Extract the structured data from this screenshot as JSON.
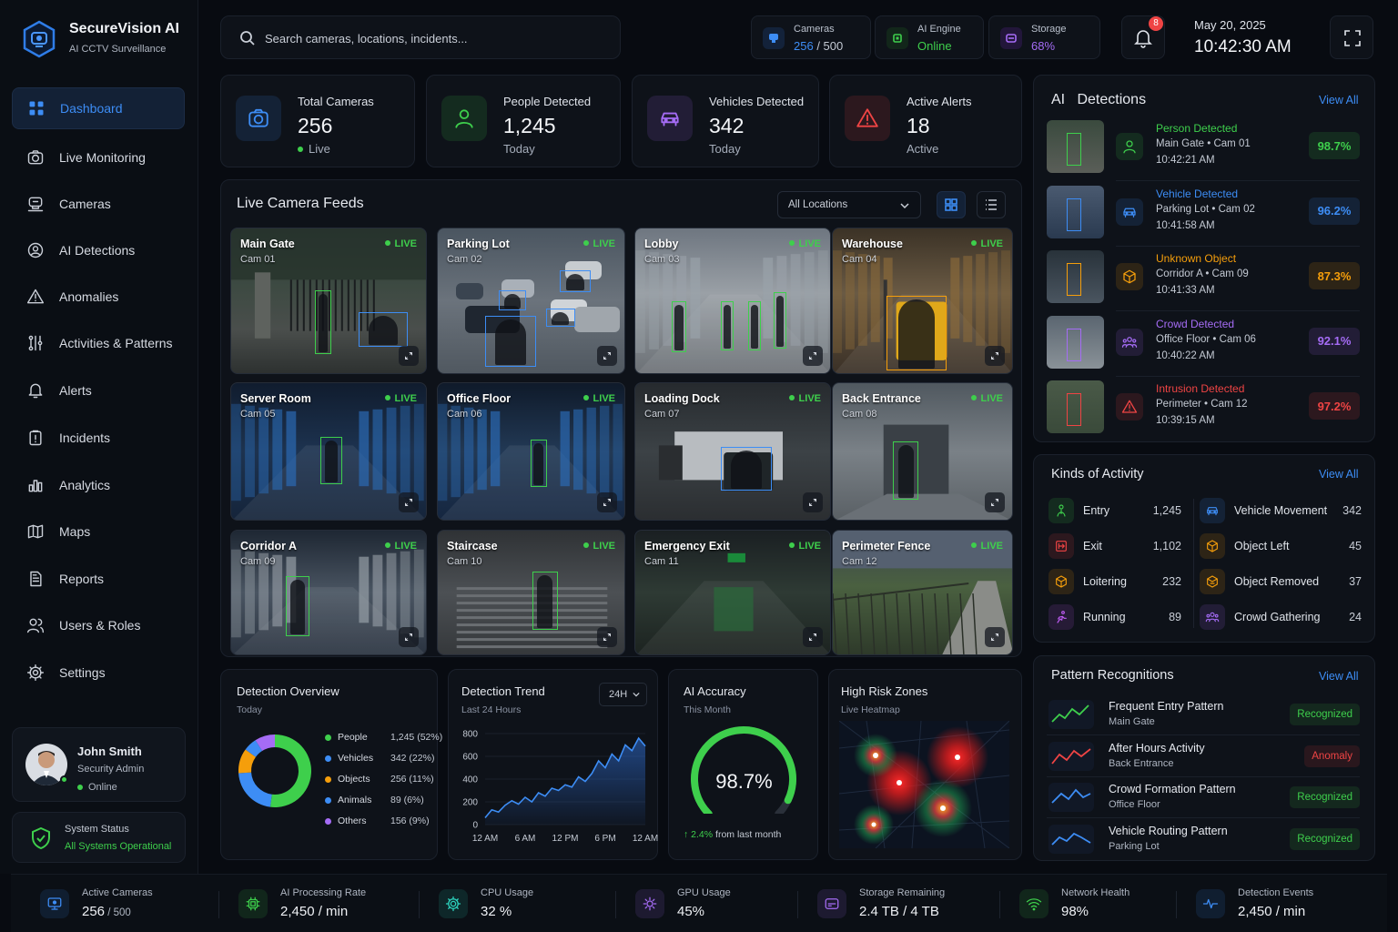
{
  "brand": {
    "name": "SecureVision AI",
    "tagline": "AI CCTV Surveillance"
  },
  "nav": [
    {
      "label": "Dashboard",
      "icon": "grid-icon",
      "active": true
    },
    {
      "label": "Live Monitoring",
      "icon": "camera-icon"
    },
    {
      "label": "Cameras",
      "icon": "cctv-icon"
    },
    {
      "label": "AI Detections",
      "icon": "face-scan-icon"
    },
    {
      "label": "Anomalies",
      "icon": "warning-icon"
    },
    {
      "label": "Activities & Patterns",
      "icon": "pattern-icon"
    },
    {
      "label": "Alerts",
      "icon": "bell-icon"
    },
    {
      "label": "Incidents",
      "icon": "clipboard-icon"
    },
    {
      "label": "Analytics",
      "icon": "bar-chart-icon"
    },
    {
      "label": "Maps",
      "icon": "map-icon"
    },
    {
      "label": "Reports",
      "icon": "document-icon"
    },
    {
      "label": "Users & Roles",
      "icon": "users-icon"
    },
    {
      "label": "Settings",
      "icon": "gear-icon"
    }
  ],
  "user": {
    "name": "John Smith",
    "role": "Security Admin",
    "status": "Online"
  },
  "system": {
    "label": "System Status",
    "value": "All Systems Operational"
  },
  "search": {
    "placeholder": "Search cameras, locations, incidents..."
  },
  "header": {
    "cameras": {
      "label": "Cameras",
      "active": "256",
      "total": "/ 500"
    },
    "engine": {
      "label": "AI Engine",
      "value": "Online"
    },
    "storage": {
      "label": "Storage",
      "value": "68%"
    },
    "notifications": "8",
    "date": "May 20, 2025",
    "time": "10:42:30 AM"
  },
  "stats": [
    {
      "title": "Total Cameras",
      "value": "256",
      "sub": "Live",
      "icon": "camera-icon",
      "color": "#3d8df5"
    },
    {
      "title": "People Detected",
      "value": "1,245",
      "sub": "Today",
      "icon": "person-icon",
      "color": "#3ecf4c"
    },
    {
      "title": "Vehicles Detected",
      "value": "342",
      "sub": "Today",
      "icon": "car-icon",
      "color": "#a56cf5"
    },
    {
      "title": "Active Alerts",
      "value": "18",
      "sub": "Active",
      "icon": "alert-icon",
      "color": "#ef4444"
    }
  ],
  "feeds": {
    "title": "Live Camera Feeds",
    "filter": "All Locations",
    "live_label": "LIVE",
    "cameras": [
      {
        "name": "Main Gate",
        "cam": "Cam 01"
      },
      {
        "name": "Parking Lot",
        "cam": "Cam 02"
      },
      {
        "name": "Lobby",
        "cam": "Cam 03"
      },
      {
        "name": "Warehouse",
        "cam": "Cam 04"
      },
      {
        "name": "Server Room",
        "cam": "Cam 05"
      },
      {
        "name": "Office Floor",
        "cam": "Cam 06"
      },
      {
        "name": "Loading Dock",
        "cam": "Cam 07"
      },
      {
        "name": "Back Entrance",
        "cam": "Cam 08"
      },
      {
        "name": "Corridor A",
        "cam": "Cam 09"
      },
      {
        "name": "Staircase",
        "cam": "Cam 10"
      },
      {
        "name": "Emergency Exit",
        "cam": "Cam 11"
      },
      {
        "name": "Perimeter Fence",
        "cam": "Cam 12"
      }
    ]
  },
  "detections": {
    "title_ai": "AI",
    "title": "Detections",
    "view_all": "View All",
    "items": [
      {
        "type": "Person Detected",
        "loc": "Main Gate • Cam 01",
        "time": "10:42:21 AM",
        "conf": "98.7%",
        "color": "#3ecf4c",
        "icon": "person-icon"
      },
      {
        "type": "Vehicle Detected",
        "loc": "Parking Lot • Cam 02",
        "time": "10:41:58 AM",
        "conf": "96.2%",
        "color": "#3d8df5",
        "icon": "car-icon"
      },
      {
        "type": "Unknown Object",
        "loc": "Corridor A • Cam 09",
        "time": "10:41:33 AM",
        "conf": "87.3%",
        "color": "#f59e0b",
        "icon": "box-icon"
      },
      {
        "type": "Crowd Detected",
        "loc": "Office Floor • Cam 06",
        "time": "10:40:22 AM",
        "conf": "92.1%",
        "color": "#a56cf5",
        "icon": "crowd-icon"
      },
      {
        "type": "Intrusion Detected",
        "loc": "Perimeter • Cam 12",
        "time": "10:39:15 AM",
        "conf": "97.2%",
        "color": "#ef4444",
        "icon": "alert-icon"
      }
    ]
  },
  "activity": {
    "title": "Kinds of Activity",
    "view_all": "View All",
    "items": [
      {
        "name": "Entry",
        "count": "1,245",
        "color": "#3ecf4c",
        "icon": "entry-icon"
      },
      {
        "name": "Vehicle Movement",
        "count": "342",
        "color": "#3d8df5",
        "icon": "car-icon"
      },
      {
        "name": "Exit",
        "count": "1,102",
        "color": "#ef4444",
        "icon": "exit-icon"
      },
      {
        "name": "Object Left",
        "count": "45",
        "color": "#f59e0b",
        "icon": "box-icon"
      },
      {
        "name": "Loitering",
        "count": "232",
        "color": "#f59e0b",
        "icon": "box-icon"
      },
      {
        "name": "Object Removed",
        "count": "37",
        "color": "#f59e0b",
        "icon": "box-remove-icon"
      },
      {
        "name": "Running",
        "count": "89",
        "color": "#c05cf5",
        "icon": "running-icon"
      },
      {
        "name": "Crowd Gathering",
        "count": "24",
        "color": "#a56cf5",
        "icon": "crowd-icon"
      }
    ]
  },
  "patterns": {
    "title": "Pattern Recognitions",
    "view_all": "View All",
    "items": [
      {
        "name": "Frequent Entry Pattern",
        "loc": "Main Gate",
        "badge": "Recognized",
        "color": "#3ecf4c"
      },
      {
        "name": "After Hours Activity",
        "loc": "Back Entrance",
        "badge": "Anomaly",
        "color": "#ef4444"
      },
      {
        "name": "Crowd Formation Pattern",
        "loc": "Office Floor",
        "badge": "Recognized",
        "color": "#3d8df5"
      },
      {
        "name": "Vehicle Routing Pattern",
        "loc": "Parking Lot",
        "badge": "Recognized",
        "color": "#3d8df5"
      }
    ]
  },
  "overview": {
    "title": "Detection Overview",
    "sub": "Today"
  },
  "trend": {
    "title": "Detection Trend",
    "sub": "Last 24 Hours",
    "range": "24H"
  },
  "accuracy": {
    "title": "AI Accuracy",
    "sub": "This Month",
    "value": "98.7%",
    "fraction": 0.987,
    "delta": "2.4%",
    "delta_text": "from last month"
  },
  "heatmap": {
    "title": "High Risk Zones",
    "sub": "Live Heatmap"
  },
  "chart_data": [
    {
      "type": "pie",
      "title": "Detection Overview",
      "categories": [
        "People",
        "Vehicles",
        "Objects",
        "Animals",
        "Others"
      ],
      "values": [
        1245,
        342,
        256,
        89,
        156
      ],
      "labels": [
        "1,245 (52%)",
        "342 (22%)",
        "256 (11%)",
        "89 (6%)",
        "156 (9%)"
      ],
      "percents": [
        52,
        22,
        11,
        6,
        9
      ],
      "colors": [
        "#3ecf4c",
        "#3d8df5",
        "#f59e0b",
        "#3d8df5",
        "#a56cf5"
      ],
      "legend": "right"
    },
    {
      "type": "area",
      "title": "Detection Trend",
      "x": [
        "12 AM",
        "",
        "",
        "",
        "",
        "",
        "6 AM",
        "",
        "",
        "",
        "",
        "",
        "12 PM",
        "",
        "",
        "",
        "",
        "",
        "6 PM",
        "",
        "",
        "",
        "",
        "",
        "12 AM"
      ],
      "xticks": [
        "12 AM",
        "6 AM",
        "12 PM",
        "6 PM",
        "12 AM"
      ],
      "values": [
        60,
        130,
        110,
        170,
        210,
        180,
        240,
        200,
        280,
        250,
        320,
        300,
        350,
        330,
        420,
        380,
        450,
        560,
        500,
        620,
        560,
        700,
        650,
        760,
        690
      ],
      "ylim": [
        0,
        800
      ],
      "yticks": [
        0,
        200,
        400,
        600,
        800
      ],
      "color": "#3d8df5"
    }
  ],
  "footer": [
    {
      "label": "Active Cameras",
      "value": "256",
      "suffix": " / 500",
      "icon": "monitor-icon",
      "color": "#3d8df5"
    },
    {
      "label": "AI Processing Rate",
      "value": "2,450 / min",
      "suffix": "",
      "icon": "chip-icon",
      "color": "#3ecf4c"
    },
    {
      "label": "CPU Usage",
      "value": "32 %",
      "suffix": "",
      "icon": "cpu-icon",
      "color": "#2dd4bf"
    },
    {
      "label": "GPU Usage",
      "value": "45%",
      "suffix": "",
      "icon": "gpu-icon",
      "color": "#a56cf5"
    },
    {
      "label": "Storage Remaining",
      "value": "2.4 TB / 4 TB",
      "suffix": "",
      "icon": "storage-icon",
      "color": "#a56cf5"
    },
    {
      "label": "Network Health",
      "value": "98%",
      "suffix": "",
      "icon": "wifi-icon",
      "color": "#3ecf4c"
    },
    {
      "label": "Detection Events",
      "value": "2,450 / min",
      "suffix": "",
      "icon": "pulse-icon",
      "color": "#3d8df5"
    }
  ]
}
